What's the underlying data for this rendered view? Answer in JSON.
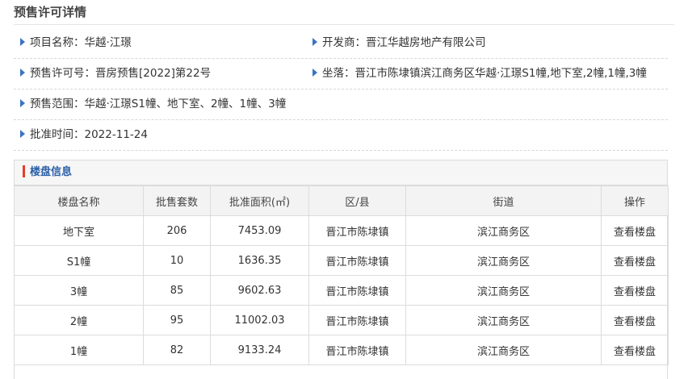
{
  "page_title": "预售许可详情",
  "info": {
    "project_name": "项目名称：华越·江璟",
    "developer": "开发商：晋江华越房地产有限公司",
    "permit_no": "预售许可号：晋房预售[2022]第22号",
    "location": "坐落：晋江市陈埭镇滨江商务区华越·江璟S1幢,地下室,2幢,1幢,3幢",
    "presale_scope": "预售范围：华越·江璟S1幢、地下室、2幢、1幢、3幢",
    "approval_time": "批准时间：2022-11-24"
  },
  "building_panel": {
    "title": "楼盘信息",
    "columns": [
      "楼盘名称",
      "批售套数",
      "批准面积(㎡)",
      "区/县",
      "街道",
      "操作"
    ],
    "rows": [
      [
        "地下室",
        "206",
        "7453.09",
        "晋江市陈埭镇",
        "滨江商务区",
        "查看楼盘"
      ],
      [
        "S1幢",
        "10",
        "1636.35",
        "晋江市陈埭镇",
        "滨江商务区",
        "查看楼盘"
      ],
      [
        "3幢",
        "85",
        "9602.63",
        "晋江市陈埭镇",
        "滨江商务区",
        "查看楼盘"
      ],
      [
        "2幢",
        "95",
        "11002.03",
        "晋江市陈埭镇",
        "滨江商务区",
        "查看楼盘"
      ],
      [
        "1幢",
        "82",
        "9133.24",
        "晋江市陈埭镇",
        "滨江商务区",
        "查看楼盘"
      ]
    ]
  },
  "colors": {
    "arrow": "#3a74c2",
    "panel_title": "#2a5fa8",
    "panel_marker": "#e53d2a"
  }
}
